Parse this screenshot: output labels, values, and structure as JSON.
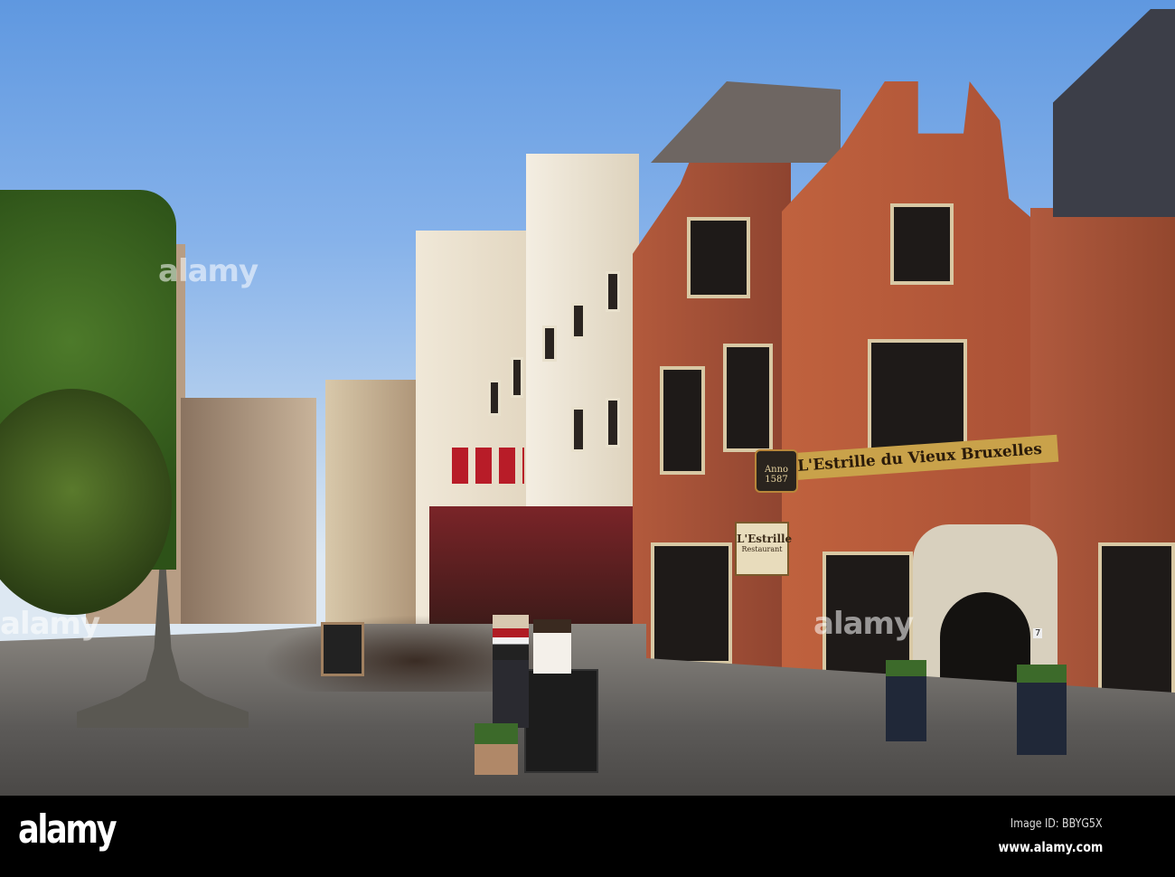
{
  "photo": {
    "subject": "Street with restaurants",
    "signs": {
      "anno": "Anno 1587",
      "main_sign": "L'Estrille du Vieux Bruxelles",
      "hanging_sign_name": "L'Estrille",
      "hanging_sign_sub": "Restaurant",
      "door_number": "7"
    },
    "watermark": "alamy"
  },
  "footer": {
    "logo": "alamy",
    "image_id": "Image ID: BBYG5X",
    "url": "www.alamy.com"
  },
  "colors": {
    "brick": "#a5523a",
    "sky": "#6fa3e0",
    "sign_gold": "#c9a24a"
  }
}
